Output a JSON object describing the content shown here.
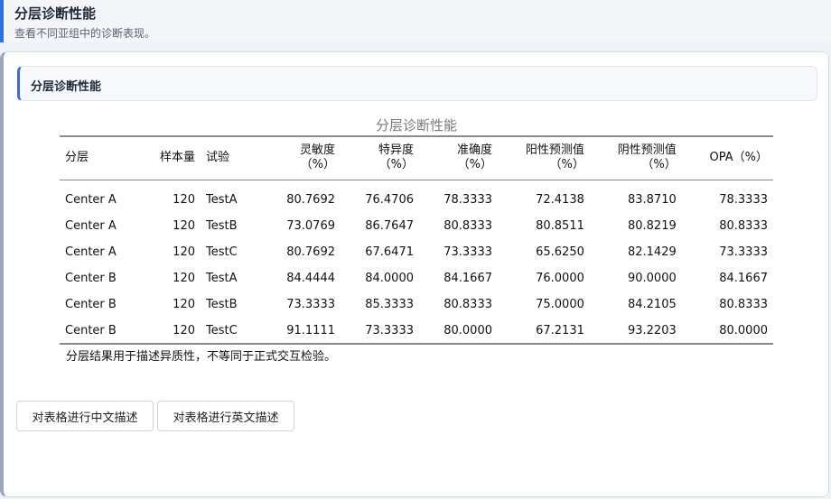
{
  "header": {
    "title": "分层诊断性能",
    "subtitle": "查看不同亚组中的诊断表现。"
  },
  "section": {
    "title": "分层诊断性能"
  },
  "table": {
    "caption": "分层诊断性能",
    "columns": [
      "分层",
      "样本量",
      "试验",
      "灵敏度\n（%）",
      "特异度\n（%）",
      "准确度\n（%）",
      "阳性预测值\n（%）",
      "阴性预测值\n（%）",
      "OPA（%）"
    ],
    "rows": [
      [
        "Center A",
        "120",
        "TestA",
        "80.7692",
        "76.4706",
        "78.3333",
        "72.4138",
        "83.8710",
        "78.3333"
      ],
      [
        "Center A",
        "120",
        "TestB",
        "73.0769",
        "86.7647",
        "80.8333",
        "80.8511",
        "80.8219",
        "80.8333"
      ],
      [
        "Center A",
        "120",
        "TestC",
        "80.7692",
        "67.6471",
        "73.3333",
        "65.6250",
        "82.1429",
        "73.3333"
      ],
      [
        "Center B",
        "120",
        "TestA",
        "84.4444",
        "84.0000",
        "84.1667",
        "76.0000",
        "90.0000",
        "84.1667"
      ],
      [
        "Center B",
        "120",
        "TestB",
        "73.3333",
        "85.3333",
        "80.8333",
        "75.0000",
        "84.2105",
        "80.8333"
      ],
      [
        "Center B",
        "120",
        "TestC",
        "91.1111",
        "73.3333",
        "80.0000",
        "67.2131",
        "93.2203",
        "80.0000"
      ]
    ],
    "footnote": "分层结果用于描述异质性，不等同于正式交互检验。"
  },
  "buttons": {
    "describe_cn": "对表格进行中文描述",
    "describe_en": "对表格进行英文描述"
  }
}
